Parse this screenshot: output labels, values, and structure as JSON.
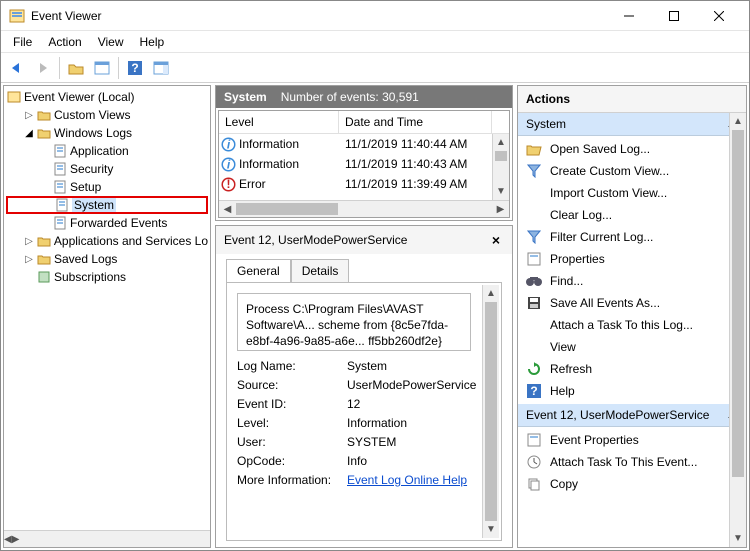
{
  "title": "Event Viewer",
  "menus": {
    "file": "File",
    "action": "Action",
    "view": "View",
    "help": "Help"
  },
  "tree": {
    "root": "Event Viewer (Local)",
    "customViews": "Custom Views",
    "windowsLogs": "Windows Logs",
    "application": "Application",
    "security": "Security",
    "setup": "Setup",
    "system": "System",
    "forwarded": "Forwarded Events",
    "appsServices": "Applications and Services Lo",
    "savedLogs": "Saved Logs",
    "subscriptions": "Subscriptions"
  },
  "header": {
    "logName": "System",
    "countLabel": "Number of events: 30,591"
  },
  "columns": {
    "level": "Level",
    "dateTime": "Date and Time"
  },
  "rows": [
    {
      "level": "Information",
      "dt": "11/1/2019 11:40:44 AM",
      "type": "info"
    },
    {
      "level": "Information",
      "dt": "11/1/2019 11:40:43 AM",
      "type": "info"
    },
    {
      "level": "Error",
      "dt": "11/1/2019 11:39:49 AM",
      "type": "error"
    }
  ],
  "detailTitle": "Event 12, UserModePowerService",
  "tabs": {
    "general": "General",
    "details": "Details"
  },
  "message": "Process C:\\Program Files\\AVAST Software\\A... scheme from {8c5e7fda-e8bf-4a96-9a85-a6e... ff5bb260df2e}",
  "fields": {
    "logName": {
      "label": "Log Name:",
      "value": "System"
    },
    "source": {
      "label": "Source:",
      "value": "UserModePowerService"
    },
    "eventId": {
      "label": "Event ID:",
      "value": "12"
    },
    "level": {
      "label": "Level:",
      "value": "Information"
    },
    "user": {
      "label": "User:",
      "value": "SYSTEM"
    },
    "opcode": {
      "label": "OpCode:",
      "value": "Info"
    },
    "moreInfo": {
      "label": "More Information:",
      "value": "Event Log Online Help"
    }
  },
  "actions": {
    "title": "Actions",
    "section1": "System",
    "section2": "Event 12, UserModePowerService",
    "items1": {
      "open": "Open Saved Log...",
      "create": "Create Custom View...",
      "import": "Import Custom View...",
      "clear": "Clear Log...",
      "filter": "Filter Current Log...",
      "props": "Properties",
      "find": "Find...",
      "save": "Save All Events As...",
      "attach": "Attach a Task To this Log...",
      "view": "View",
      "refresh": "Refresh",
      "help": "Help"
    },
    "items2": {
      "props": "Event Properties",
      "attach": "Attach Task To This Event...",
      "copy": "Copy"
    }
  }
}
